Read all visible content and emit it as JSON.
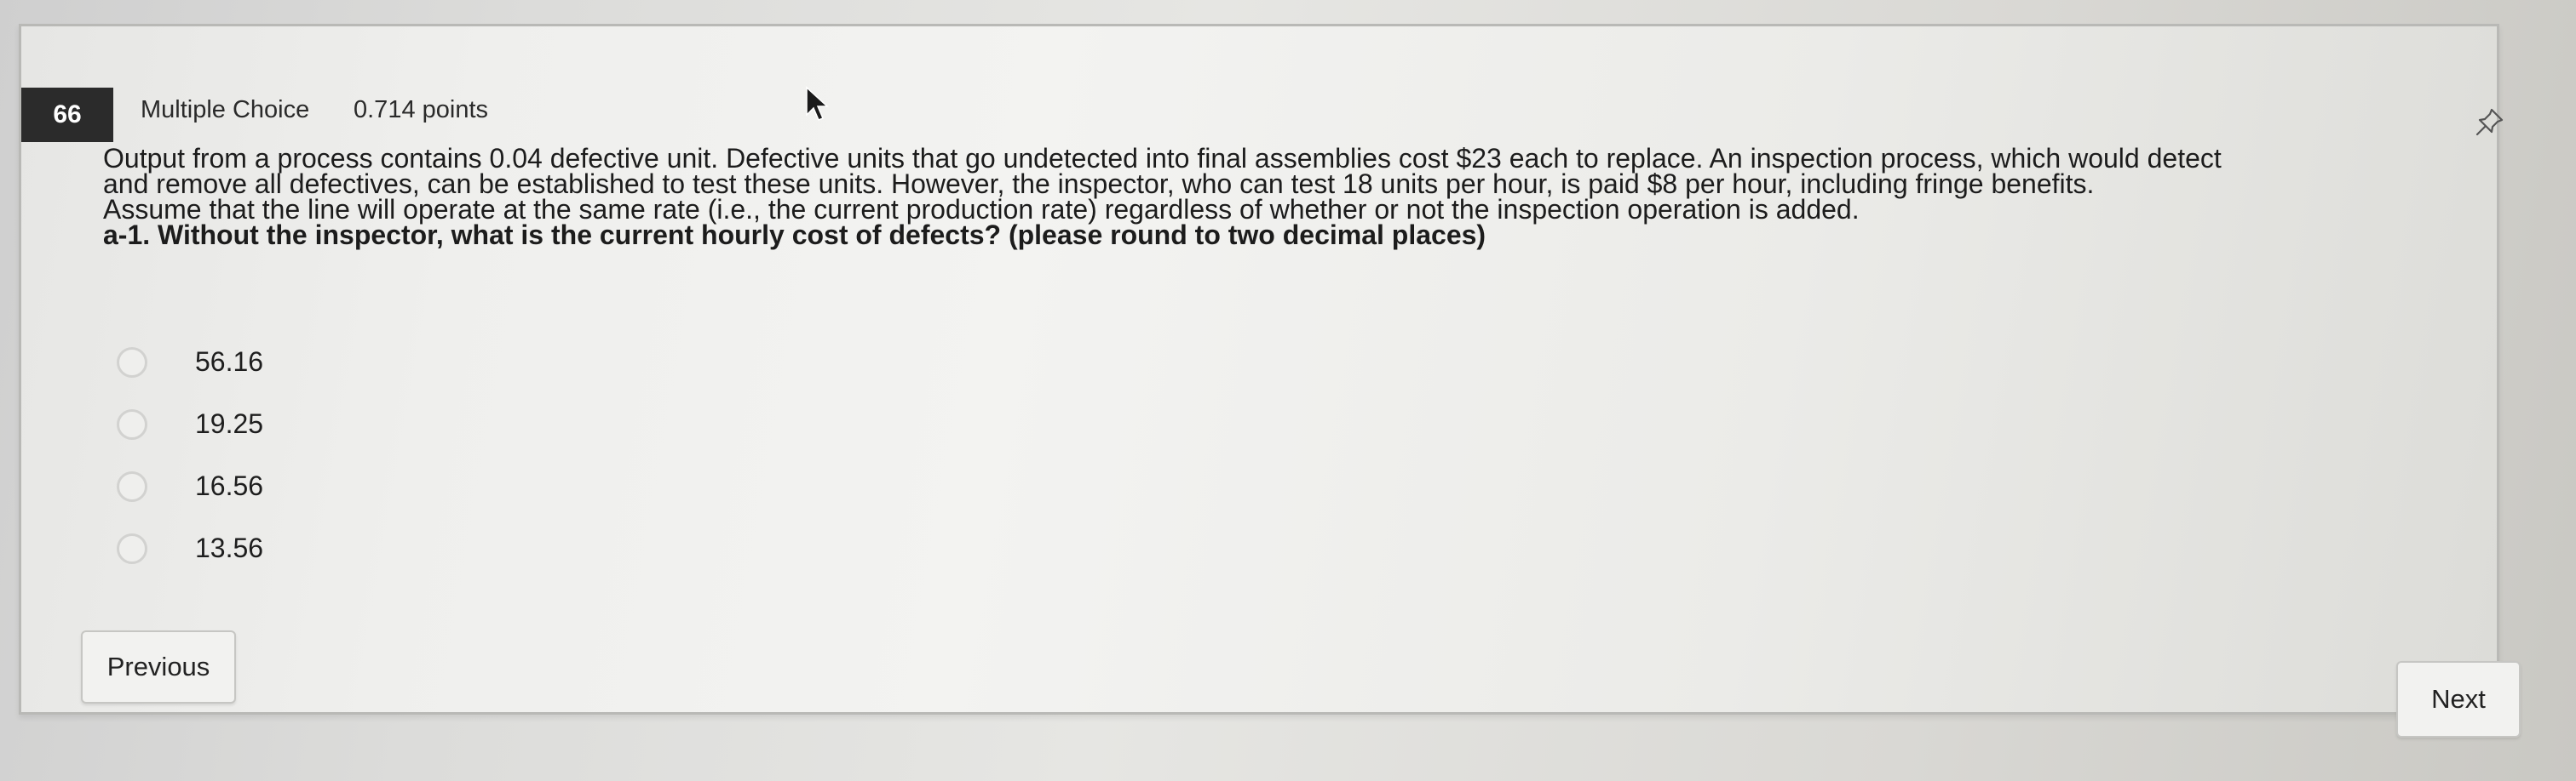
{
  "question": {
    "number": "66",
    "type": "Multiple Choice",
    "points": "0.714 points",
    "lines": [
      "Output from a process contains 0.04 defective unit. Defective units that go undetected into final assemblies cost $23 each to replace. An inspection process, which would detect",
      "and remove all defectives, can be established to test these units. However, the inspector, who can test 18 units per hour, is paid $8 per hour, including fringe benefits.",
      "Assume that the line will operate at the same rate (i.e., the current production rate) regardless of whether or not the inspection operation is added.",
      "a-1. Without the inspector, what is the current hourly cost of defects? (please round to two decimal places)"
    ]
  },
  "options": [
    {
      "label": "56.16"
    },
    {
      "label": "19.25"
    },
    {
      "label": "16.56"
    },
    {
      "label": "13.56"
    }
  ],
  "navigation": {
    "previous_label": "Previous",
    "next_label": "Next"
  },
  "icons": {
    "pin": "pushpin-icon",
    "cursor": "mouse-pointer-icon"
  }
}
